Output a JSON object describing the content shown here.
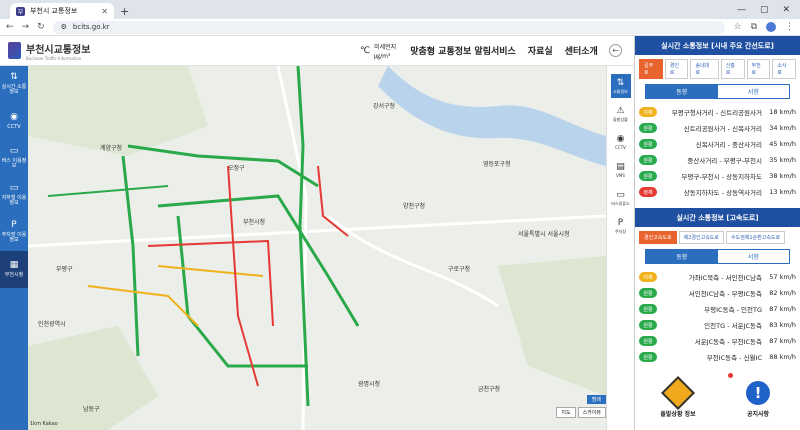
{
  "browser": {
    "tab_title": "부천시 교통정보",
    "tab_favicon": "부",
    "url": "bcits.go.kr"
  },
  "header": {
    "logo_title": "부천시교통정보",
    "logo_sub": "Bucheon Traffic Information",
    "weather_temp": "℃",
    "weather_label": "미세먼지",
    "weather_unit": "㎍/m³",
    "menu": [
      "맞춤형 교통정보 알림서비스",
      "자료실",
      "센터소개"
    ]
  },
  "left_nav": [
    {
      "label": "실시간 소통정보",
      "icon": "⇅",
      "active": false
    },
    {
      "label": "CCTV",
      "icon": "◉",
      "active": false
    },
    {
      "label": "버스 이용정보",
      "icon": "▭",
      "active": false
    },
    {
      "label": "지하철 이용정보",
      "icon": "▭",
      "active": false
    },
    {
      "label": "주차장 이용정보",
      "icon": "P",
      "active": false
    },
    {
      "label": "부천시청",
      "icon": "▦",
      "active": true
    }
  ],
  "map_tools": [
    {
      "label": "소통정보",
      "icon": "⇅",
      "active": true
    },
    {
      "label": "돌발상황",
      "icon": "⚠",
      "active": false
    },
    {
      "label": "CCTV",
      "icon": "◉",
      "active": false
    },
    {
      "label": "VMS",
      "icon": "▤",
      "active": false
    },
    {
      "label": "버스정류소",
      "icon": "▭",
      "active": false
    },
    {
      "label": "주차장",
      "icon": "P",
      "active": false
    }
  ],
  "map_legend": {
    "a": "범례",
    "b1": "지도",
    "b2": "스카이뷰"
  },
  "map_scale": "1km Kakao",
  "map_labels": [
    "강서구청",
    "양천구청",
    "영등포구청",
    "계양구청",
    "부평구",
    "오정구",
    "부천시청",
    "구로구청",
    "남동구",
    "금천구청",
    "광명시청",
    "인천광역시",
    "서울특별시 서울시청"
  ],
  "colors": {
    "brand": "#2a6ebd",
    "smooth": "#2aa94a",
    "slow": "#f0b21c",
    "jam": "#e53935"
  },
  "panel1": {
    "title": "실시간 소통정보 [시내 주요 간선도로]",
    "road_tabs": [
      "길주로",
      "경인로",
      "송내대로",
      "신흥로",
      "부천로",
      "소사로"
    ],
    "dir_tabs": [
      "동향",
      "서향"
    ],
    "rows": [
      {
        "status": "지체",
        "color": "#f0b21c",
        "name": "부평구청사거리 - 신트리공원사거",
        "speed": "18 km/h"
      },
      {
        "status": "원활",
        "color": "#2aa94a",
        "name": "신트리공원사거 - 신복사거리",
        "speed": "34 km/h"
      },
      {
        "status": "원활",
        "color": "#2aa94a",
        "name": "신복사거리 - 중산사거리",
        "speed": "45 km/h"
      },
      {
        "status": "원활",
        "color": "#2aa94a",
        "name": "중산사거리 - 부평구-부천시",
        "speed": "35 km/h"
      },
      {
        "status": "원활",
        "color": "#2aa94a",
        "name": "부평구-부천시 - 상동지하차도",
        "speed": "38 km/h"
      },
      {
        "status": "정체",
        "color": "#e53935",
        "name": "상동지하차도 - 상동역사거리",
        "speed": "13 km/h"
      }
    ]
  },
  "panel2": {
    "title": "실시간 소통정보 [고속도로]",
    "road_tabs": [
      "경인고속도로",
      "제2경인고속도로",
      "수도권제1순환고속도로"
    ],
    "dir_tabs": [
      "동향",
      "서향"
    ],
    "rows": [
      {
        "status": "지체",
        "color": "#f0b21c",
        "name": "가좌IC북측 - 서인천IC남측",
        "speed": "57 km/h"
      },
      {
        "status": "원활",
        "color": "#2aa94a",
        "name": "서인천IC남측 - 부평IC동측",
        "speed": "82 km/h"
      },
      {
        "status": "원활",
        "color": "#2aa94a",
        "name": "부평IC동측 - 인천TG",
        "speed": "87 km/h"
      },
      {
        "status": "원활",
        "color": "#2aa94a",
        "name": "인천TG - 서운JC동측",
        "speed": "83 km/h"
      },
      {
        "status": "원활",
        "color": "#2aa94a",
        "name": "서운JC동측 - 부천IC동측",
        "speed": "87 km/h"
      },
      {
        "status": "원활",
        "color": "#2aa94a",
        "name": "부천IC동측 - 신월IC",
        "speed": "88 km/h"
      }
    ]
  },
  "bottom": {
    "incident": "돌발상황 정보",
    "notice": "공지사항"
  }
}
